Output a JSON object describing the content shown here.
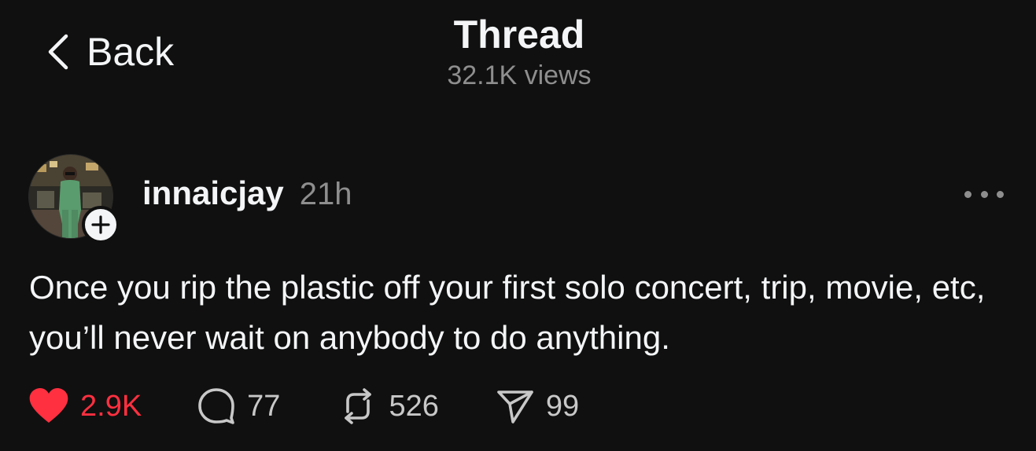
{
  "header": {
    "back_label": "Back",
    "title": "Thread",
    "views": "32.1K views"
  },
  "post": {
    "username": "innaicjay",
    "time": "21h",
    "text": "Once you rip the plastic off your first solo concert, trip, movie, etc, you’ll never wait on anybody to do anything.",
    "actions": {
      "likes": "2.9K",
      "replies": "77",
      "reposts": "526",
      "shares": "99",
      "liked": true
    }
  },
  "icons": {
    "back": "chevron-left-icon",
    "follow": "plus-icon",
    "more": "ellipsis-icon",
    "like": "heart-icon",
    "reply": "speech-bubble-icon",
    "repost": "repost-arrows-icon",
    "share": "paper-plane-icon"
  },
  "colors": {
    "background": "#101010",
    "text": "#f3f5f7",
    "muted": "#8e8e8e",
    "like": "#ff3040"
  }
}
